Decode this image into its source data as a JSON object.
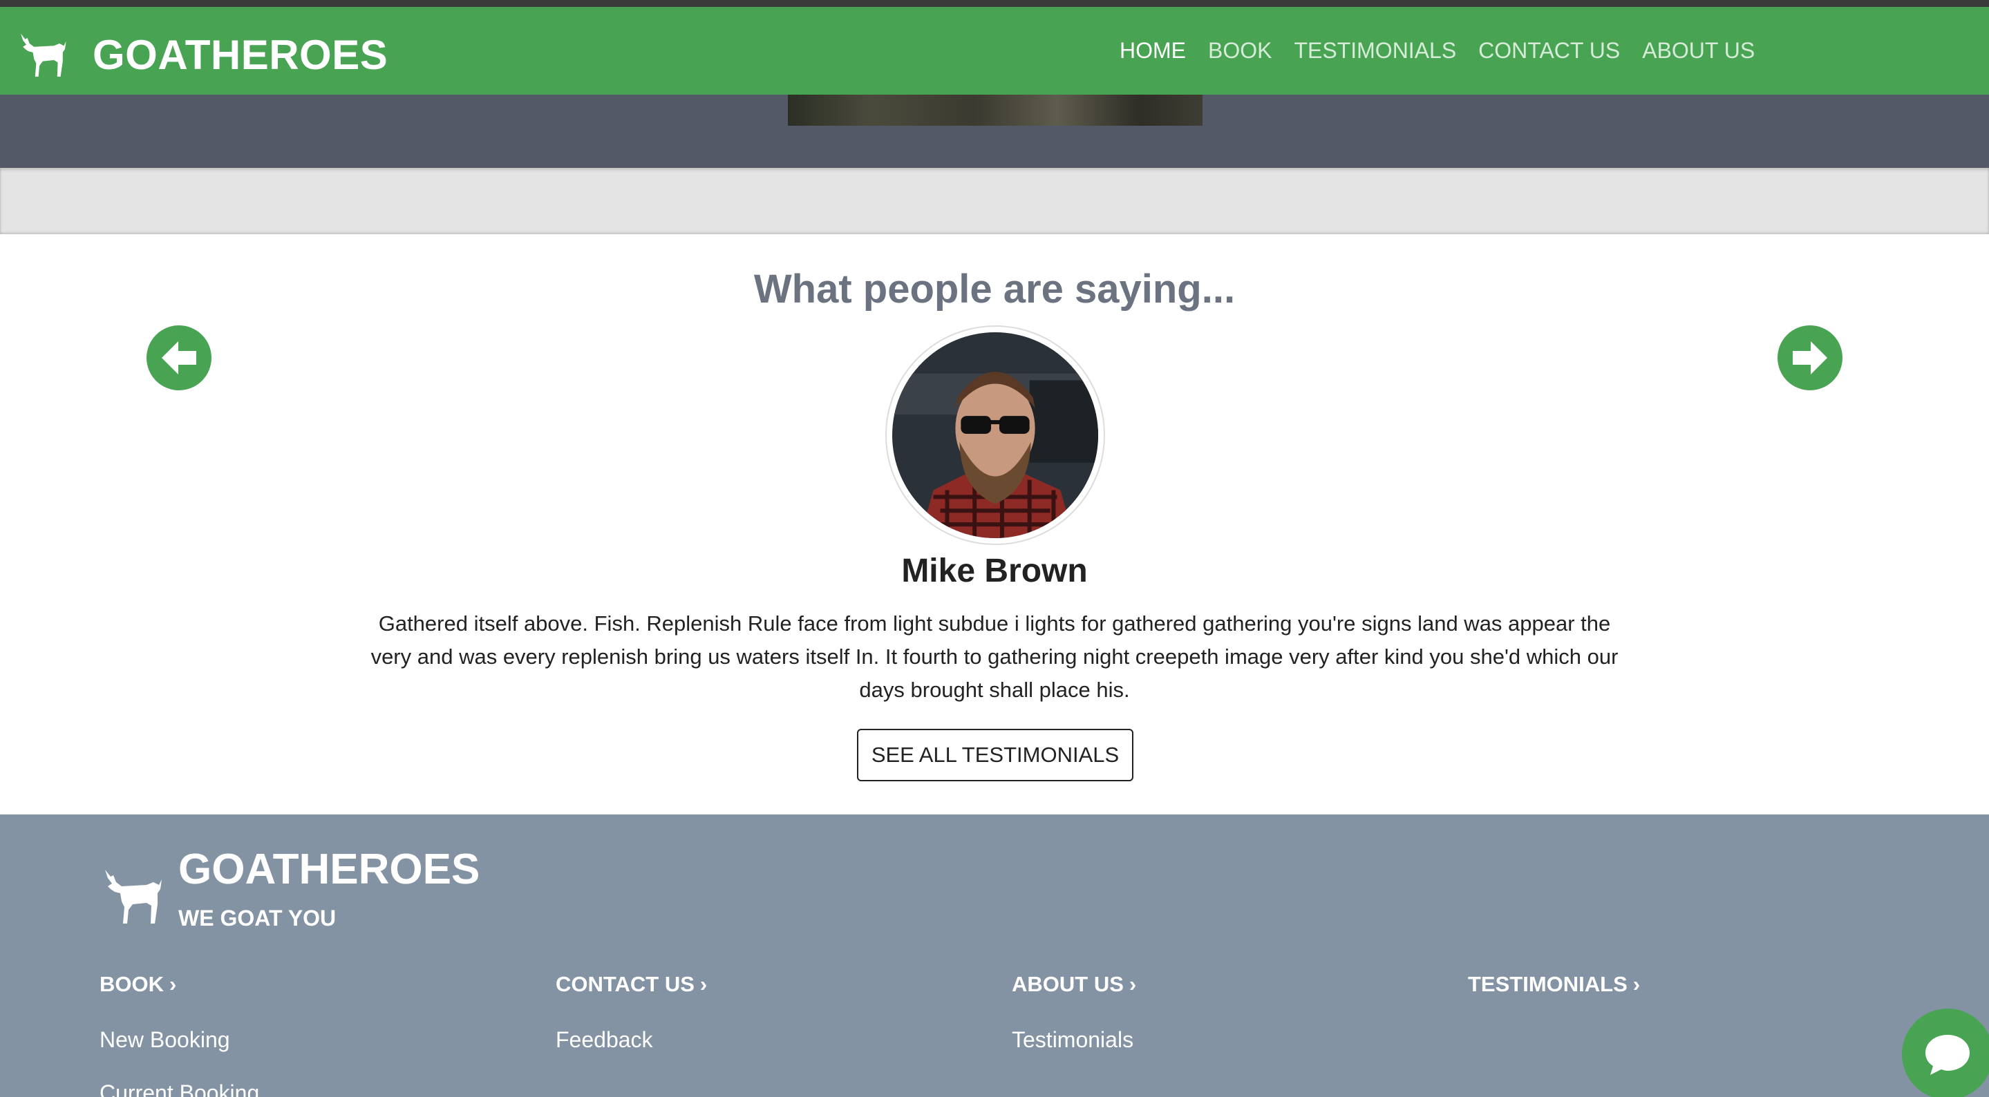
{
  "header": {
    "brand": "GOATHEROES",
    "nav": [
      {
        "label": "HOME",
        "active": true
      },
      {
        "label": "BOOK",
        "active": false
      },
      {
        "label": "TESTIMONIALS",
        "active": false
      },
      {
        "label": "CONTACT US",
        "active": false
      },
      {
        "label": "ABOUT US",
        "active": false
      }
    ]
  },
  "testimonials": {
    "heading": "What people are saying...",
    "name": "Mike Brown",
    "quote": "Gathered itself above. Fish. Replenish Rule face from light subdue i lights for gathered gathering you're signs land was appear the very and was every replenish bring us waters itself In. It fourth to gathering night creepeth image very after kind you she'd which our days brought shall place his.",
    "button_label": "SEE ALL TESTIMONIALS",
    "prev_icon": "arrow-left-circle-icon",
    "next_icon": "arrow-right-circle-icon"
  },
  "footer": {
    "brand": "GOATHEROES",
    "tagline": "WE GOAT YOU",
    "columns": [
      {
        "title": "BOOK",
        "links": [
          "New Booking",
          "Current Booking"
        ]
      },
      {
        "title": "CONTACT US",
        "links": [
          "Feedback"
        ]
      },
      {
        "title": "ABOUT US",
        "links": [
          "Testimonials"
        ]
      },
      {
        "title": "TESTIMONIALS",
        "links": []
      }
    ],
    "chevron": "›"
  },
  "chat": {
    "icon": "chat-bubble-icon"
  },
  "colors": {
    "brand_green": "#48a353",
    "hero_slate": "#535967",
    "footer_slate": "#8393a4",
    "heading_grey": "#6b7280"
  }
}
